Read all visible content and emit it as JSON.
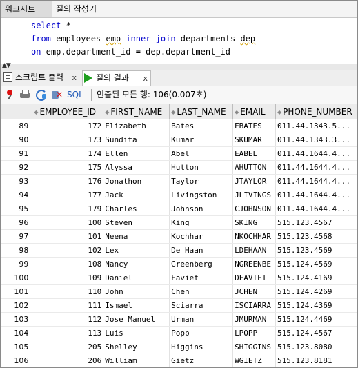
{
  "top_tabs": [
    "워크시트",
    "질의 작성기"
  ],
  "editor": {
    "line1": {
      "kw": "select",
      "rest": " *"
    },
    "line2": {
      "kw1": "from",
      "t1": " employees ",
      "alias1": "emp",
      "t2": " ",
      "kw2": "inner join",
      "t3": " departments ",
      "alias2": "dep"
    },
    "line3": {
      "kw": "on",
      "rest": " emp.department_id = dep.department_id"
    }
  },
  "result_tabs": [
    {
      "label": "스크립트 출력",
      "close": "x",
      "icon": "script-doc-icon"
    },
    {
      "label": "질의 결과",
      "close": "x",
      "icon": "run-play-icon"
    }
  ],
  "toolbar": {
    "sql_label": "SQL",
    "status": "인출된 모든 행: 106(0.007초)"
  },
  "table": {
    "columns": [
      "EMPLOYEE_ID",
      "FIRST_NAME",
      "LAST_NAME",
      "EMAIL",
      "PHONE_NUMBER"
    ],
    "rows": [
      [
        "89",
        "172",
        "Elizabeth",
        "Bates",
        "EBATES",
        "011.44.1343.5..."
      ],
      [
        "90",
        "173",
        "Sundita",
        "Kumar",
        "SKUMAR",
        "011.44.1343.3..."
      ],
      [
        "91",
        "174",
        "Ellen",
        "Abel",
        "EABEL",
        "011.44.1644.4..."
      ],
      [
        "92",
        "175",
        "Alyssa",
        "Hutton",
        "AHUTTON",
        "011.44.1644.4..."
      ],
      [
        "93",
        "176",
        "Jonathon",
        "Taylor",
        "JTAYLOR",
        "011.44.1644.4..."
      ],
      [
        "94",
        "177",
        "Jack",
        "Livingston",
        "JLIVINGS",
        "011.44.1644.4..."
      ],
      [
        "95",
        "179",
        "Charles",
        "Johnson",
        "CJOHNSON",
        "011.44.1644.4..."
      ],
      [
        "96",
        "100",
        "Steven",
        "King",
        "SKING",
        "515.123.4567"
      ],
      [
        "97",
        "101",
        "Neena",
        "Kochhar",
        "NKOCHHAR",
        "515.123.4568"
      ],
      [
        "98",
        "102",
        "Lex",
        "De Haan",
        "LDEHAAN",
        "515.123.4569"
      ],
      [
        "99",
        "108",
        "Nancy",
        "Greenberg",
        "NGREENBE",
        "515.124.4569"
      ],
      [
        "100",
        "109",
        "Daniel",
        "Faviet",
        "DFAVIET",
        "515.124.4169"
      ],
      [
        "101",
        "110",
        "John",
        "Chen",
        "JCHEN",
        "515.124.4269"
      ],
      [
        "102",
        "111",
        "Ismael",
        "Sciarra",
        "ISCIARRA",
        "515.124.4369"
      ],
      [
        "103",
        "112",
        "Jose Manuel",
        "Urman",
        "JMURMAN",
        "515.124.4469"
      ],
      [
        "104",
        "113",
        "Luis",
        "Popp",
        "LPOPP",
        "515.124.4567"
      ],
      [
        "105",
        "205",
        "Shelley",
        "Higgins",
        "SHIGGINS",
        "515.123.8080"
      ],
      [
        "106",
        "206",
        "William",
        "Gietz",
        "WGIETZ",
        "515.123.8181"
      ]
    ]
  }
}
